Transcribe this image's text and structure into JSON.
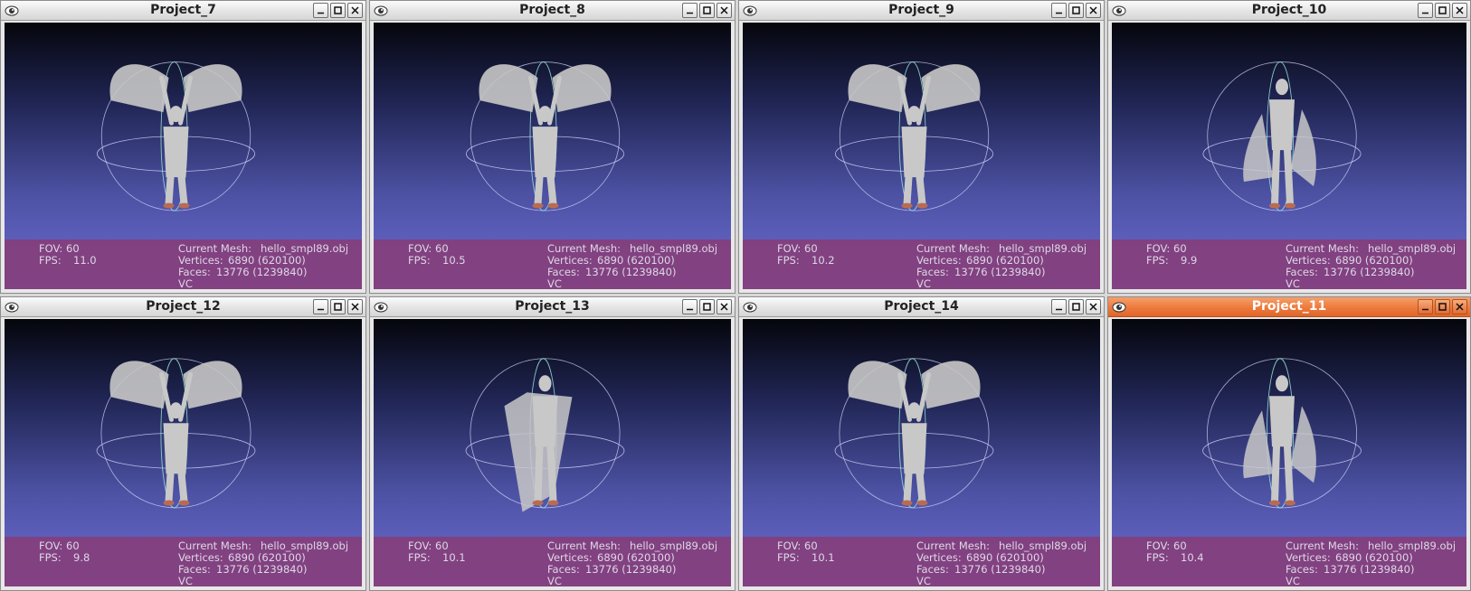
{
  "windows": [
    {
      "title": "Project_7",
      "active": false,
      "fov_label": "FOV:",
      "fov": "60",
      "fps_label": "FPS:",
      "fps": "11.0",
      "mesh_label": "Current Mesh:",
      "mesh": "hello_smpl89.obj",
      "vertices_label": "Vertices:",
      "vertices": "6890 (620100)",
      "faces_label": "Faces:",
      "faces": "13776 (1239840)",
      "mode": "VC",
      "pose": "arms-up-cape"
    },
    {
      "title": "Project_8",
      "active": false,
      "fov_label": "FOV:",
      "fov": "60",
      "fps_label": "FPS:",
      "fps": "10.5",
      "mesh_label": "Current Mesh:",
      "mesh": "hello_smpl89.obj",
      "vertices_label": "Vertices:",
      "vertices": "6890 (620100)",
      "faces_label": "Faces:",
      "faces": "13776 (1239840)",
      "mode": "VC",
      "pose": "arms-up-cape"
    },
    {
      "title": "Project_9",
      "active": false,
      "fov_label": "FOV:",
      "fov": "60",
      "fps_label": "FPS:",
      "fps": "10.2",
      "mesh_label": "Current Mesh:",
      "mesh": "hello_smpl89.obj",
      "vertices_label": "Vertices:",
      "vertices": "6890 (620100)",
      "faces_label": "Faces:",
      "faces": "13776 (1239840)",
      "mode": "VC",
      "pose": "arms-up-cape"
    },
    {
      "title": "Project_10",
      "active": false,
      "fov_label": "FOV:",
      "fov": "60",
      "fps_label": "FPS:",
      "fps": "9.9",
      "mesh_label": "Current Mesh:",
      "mesh": "hello_smpl89.obj",
      "vertices_label": "Vertices:",
      "vertices": "6890 (620100)",
      "faces_label": "Faces:",
      "faces": "13776 (1239840)",
      "mode": "VC",
      "pose": "standing-cape"
    },
    {
      "title": "Project_12",
      "active": false,
      "fov_label": "FOV:",
      "fov": "60",
      "fps_label": "FPS:",
      "fps": "9.8",
      "mesh_label": "Current Mesh:",
      "mesh": "hello_smpl89.obj",
      "vertices_label": "Vertices:",
      "vertices": "6890 (620100)",
      "faces_label": "Faces:",
      "faces": "13776 (1239840)",
      "mode": "VC",
      "pose": "arms-up-cape"
    },
    {
      "title": "Project_13",
      "active": false,
      "fov_label": "FOV:",
      "fov": "60",
      "fps_label": "FPS:",
      "fps": "10.1",
      "mesh_label": "Current Mesh:",
      "mesh": "hello_smpl89.obj",
      "vertices_label": "Vertices:",
      "vertices": "6890 (620100)",
      "faces_label": "Faces:",
      "faces": "13776 (1239840)",
      "mode": "VC",
      "pose": "turning-cape"
    },
    {
      "title": "Project_14",
      "active": false,
      "fov_label": "FOV:",
      "fov": "60",
      "fps_label": "FPS:",
      "fps": "10.1",
      "mesh_label": "Current Mesh:",
      "mesh": "hello_smpl89.obj",
      "vertices_label": "Vertices:",
      "vertices": "6890 (620100)",
      "faces_label": "Faces:",
      "faces": "13776 (1239840)",
      "mode": "VC",
      "pose": "arms-up-cape"
    },
    {
      "title": "Project_11",
      "active": true,
      "fov_label": "FOV:",
      "fov": "60",
      "fps_label": "FPS:",
      "fps": "10.4",
      "mesh_label": "Current Mesh:",
      "mesh": "hello_smpl89.obj",
      "vertices_label": "Vertices:",
      "vertices": "6890 (620100)",
      "faces_label": "Faces:",
      "faces": "13776 (1239840)",
      "mode": "VC",
      "pose": "standing-cape"
    }
  ],
  "colors": {
    "active_titlebar": "#ec7a3c",
    "overlay": "#843e7c",
    "background_top": "#05060c",
    "background_bottom": "#6d6cd2",
    "trackball_ring": "#d8d8ff",
    "trackball_axis": "#9ff0e0",
    "mesh": "#c8c8c8"
  },
  "icons": {
    "app": "meshlab-eye-icon",
    "minimize": "minimize-icon",
    "maximize": "maximize-icon",
    "close": "close-icon"
  }
}
